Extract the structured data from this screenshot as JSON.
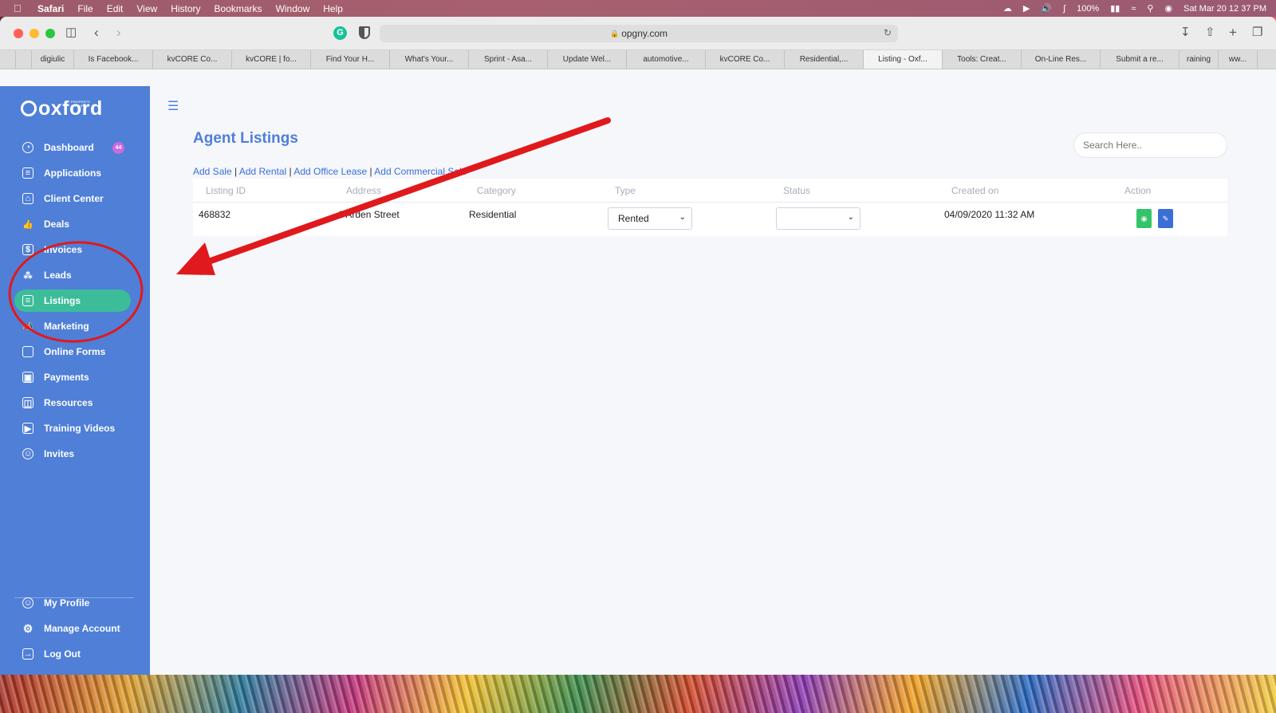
{
  "menubar": {
    "app": "Safari",
    "items": [
      "File",
      "Edit",
      "View",
      "History",
      "Bookmarks",
      "Window",
      "Help"
    ],
    "battery": "100%",
    "clock": "Sat Mar 20  12 37 PM"
  },
  "browser": {
    "url": "opgny.com",
    "tabs": [
      "digiulic",
      "Is Facebook...",
      "kvCORE Co...",
      "kvCORE | fo...",
      "Find Your H...",
      "What's Your...",
      "Sprint - Asa...",
      "Update Wel...",
      "automotive...",
      "kvCORE Co...",
      "Residential,...",
      "Listing - Oxf...",
      "Tools: Creat...",
      "On-Line Res...",
      "Submit a re...",
      "raining",
      "ww..."
    ],
    "active_tab_index": 11
  },
  "sidebar": {
    "logo": "oxford",
    "logo_tagline": "PROPERTY GROUP",
    "items": [
      {
        "label": "Dashboard",
        "icon": "dashboard-icon",
        "badge": "44"
      },
      {
        "label": "Applications",
        "icon": "document-icon"
      },
      {
        "label": "Client Center",
        "icon": "building-icon"
      },
      {
        "label": "Deals",
        "icon": "thumbs-up-icon"
      },
      {
        "label": "Invoices",
        "icon": "invoice-icon"
      },
      {
        "label": "Leads",
        "icon": "network-icon"
      },
      {
        "label": "Listings",
        "icon": "listing-icon",
        "active": true
      },
      {
        "label": "Marketing",
        "icon": "megaphone-icon"
      },
      {
        "label": "Online Forms",
        "icon": "folder-icon"
      },
      {
        "label": "Payments",
        "icon": "payment-icon"
      },
      {
        "label": "Resources",
        "icon": "book-icon"
      },
      {
        "label": "Training Videos",
        "icon": "video-icon"
      },
      {
        "label": "Invites",
        "icon": "invite-icon"
      }
    ],
    "footer": [
      {
        "label": "My Profile",
        "icon": "profile-icon"
      },
      {
        "label": "Manage Account",
        "icon": "gear-icon"
      },
      {
        "label": "Log Out",
        "icon": "logout-icon"
      }
    ]
  },
  "main": {
    "title": "Agent Listings",
    "search_placeholder": "Search Here..",
    "add_links": [
      "Add Sale",
      "Add Rental",
      "Add Office Lease",
      "Add Commercial Sale"
    ],
    "columns": [
      "Listing ID",
      "Address",
      "Category",
      "Type",
      "Status",
      "Created on",
      "Action"
    ],
    "rows": [
      {
        "listing_id": "468832",
        "address": "1 Arden Street",
        "category": "Residential",
        "type": "Rented",
        "status": "",
        "created_on": "04/09/2020 11:32 AM"
      }
    ]
  },
  "colors": {
    "sidebar_bg": "#4f7fd7",
    "active_item": "#3dbc9a",
    "title": "#4f7fd7",
    "annotation_red": "#e0191d"
  }
}
